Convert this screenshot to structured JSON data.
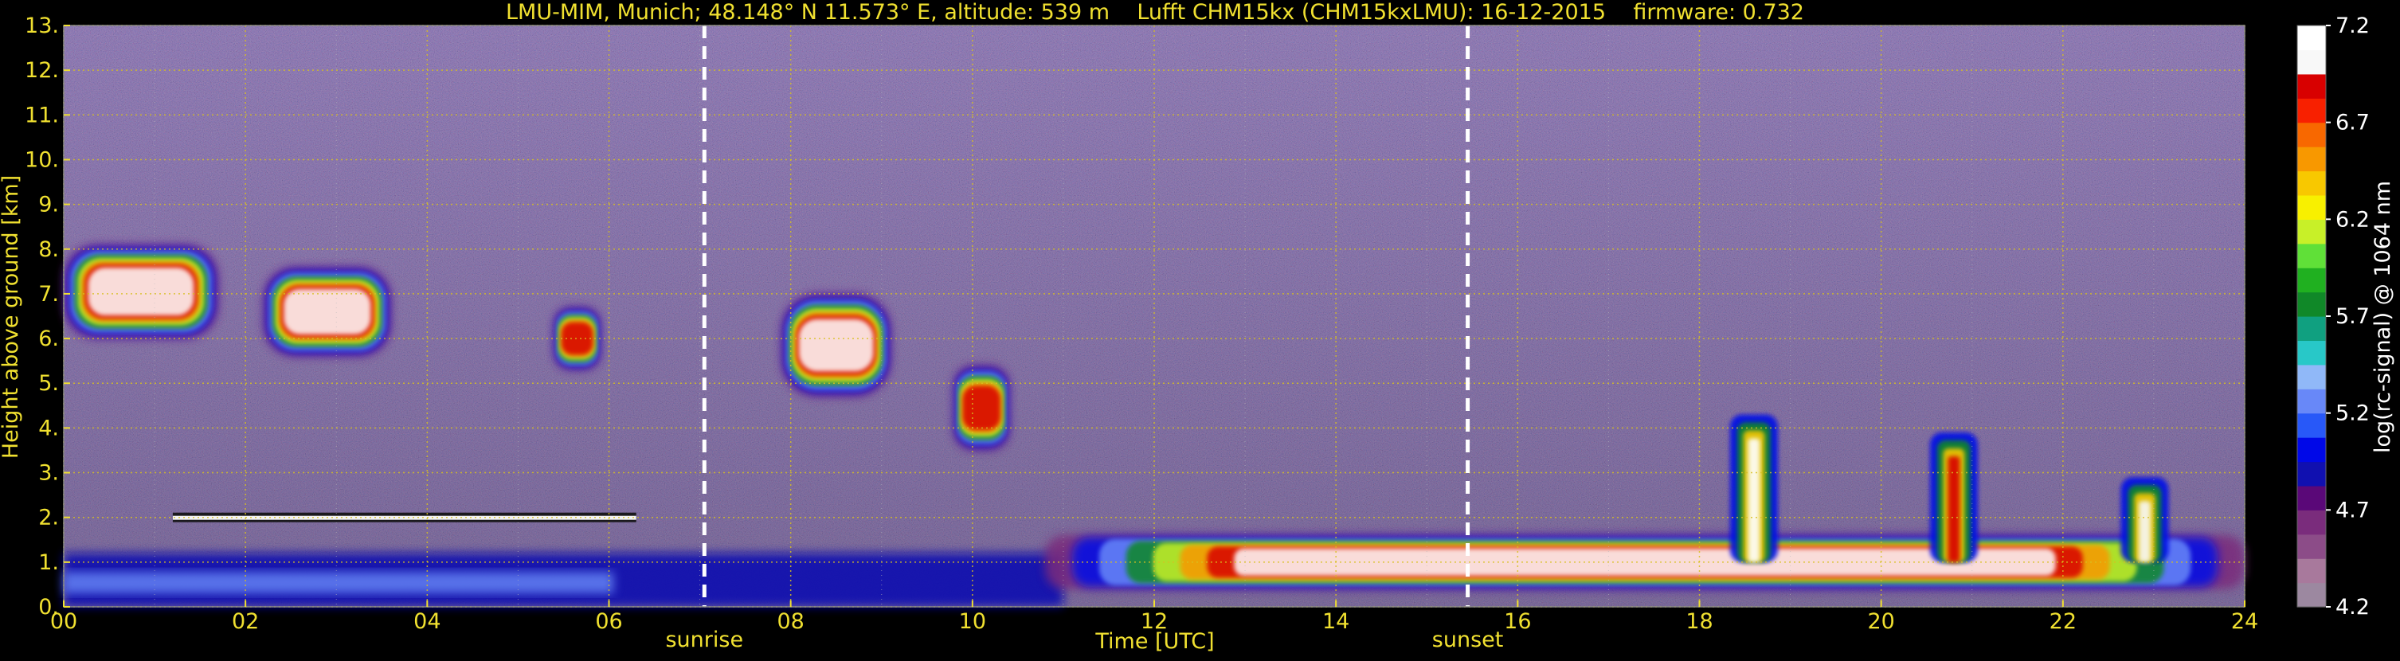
{
  "chart_data": {
    "type": "heatmap",
    "title": "LMU-MIM, Munich; 48.148° N 11.573° E, altitude: 539 m    Lufft CHM15kx (CHM15kxLMU): 16-12-2015    firmware: 0.732",
    "xlabel": "Time [UTC]",
    "ylabel": "Height above ground [km]",
    "xlim": [
      0,
      24
    ],
    "ylim": [
      0,
      13
    ],
    "x_tick_labels": [
      "00",
      "02",
      "04",
      "06",
      "08",
      "10",
      "12",
      "14",
      "16",
      "18",
      "20",
      "22",
      "24"
    ],
    "y_tick_labels": [
      "0.",
      "1.",
      "2.",
      "3.",
      "4.",
      "5.",
      "6.",
      "7.",
      "8.",
      "9.",
      "10.",
      "11.",
      "12.",
      "13."
    ],
    "grid": true,
    "annotations": [
      {
        "label": "sunrise",
        "x": 7.05
      },
      {
        "label": "sunset",
        "x": 15.45
      }
    ],
    "colorbar": {
      "label": "log(rc-signal) @ 1064 nm",
      "range": [
        4.2,
        7.2
      ],
      "tick_labels": [
        "4.2",
        "4.7",
        "5.2",
        "5.7",
        "6.2",
        "6.7",
        "7.2"
      ],
      "colors": [
        "#9c88a0",
        "#a8799c",
        "#8c4c88",
        "#7a2c7c",
        "#5a0878",
        "#1010b0",
        "#0008e8",
        "#2858f8",
        "#6888f8",
        "#90b8f8",
        "#28c8c8",
        "#10a080",
        "#108828",
        "#20b020",
        "#60e038",
        "#c8f028",
        "#f8f000",
        "#f8c800",
        "#f89800",
        "#f86800",
        "#f82000",
        "#d80000",
        "#f8f8f8",
        "#ffffff"
      ]
    },
    "features": [
      {
        "kind": "cirrus",
        "x_start": 0.0,
        "x_end": 1.7,
        "height_top": 8.1,
        "height_bottom": 6.0,
        "max_level": 7.2
      },
      {
        "kind": "cirrus",
        "x_start": 2.2,
        "x_end": 3.6,
        "height_top": 7.6,
        "height_bottom": 5.6,
        "max_level": 7.2
      },
      {
        "kind": "cirrus",
        "x_start": 5.4,
        "x_end": 5.9,
        "height_top": 6.7,
        "height_bottom": 5.3,
        "max_level": 7.0
      },
      {
        "kind": "cirrus",
        "x_start": 7.9,
        "x_end": 9.1,
        "height_top": 7.0,
        "height_bottom": 4.7,
        "max_level": 7.2
      },
      {
        "kind": "cirrus",
        "x_start": 9.8,
        "x_end": 10.4,
        "height_top": 5.4,
        "height_bottom": 3.5,
        "max_level": 7.1
      },
      {
        "kind": "residual_layer_top",
        "x_start": 1.2,
        "x_end": 6.3,
        "height": 2.0,
        "max_level": 7.2
      },
      {
        "kind": "boundary_layer",
        "x_start": 0.0,
        "x_end": 11.0,
        "height_top": 1.2,
        "max_level": 5.3
      },
      {
        "kind": "low_cloud",
        "x_start": 10.8,
        "x_end": 24.0,
        "height_top": 1.6,
        "height_bottom": 0.4,
        "max_level": 7.2
      },
      {
        "kind": "convective_plume",
        "x": 18.6,
        "height_top": 4.3,
        "max_level": 7.2
      },
      {
        "kind": "convective_plume",
        "x": 20.8,
        "height_top": 3.9,
        "max_level": 6.9
      },
      {
        "kind": "convective_plume",
        "x": 22.9,
        "height_top": 2.9,
        "max_level": 7.0
      }
    ]
  }
}
